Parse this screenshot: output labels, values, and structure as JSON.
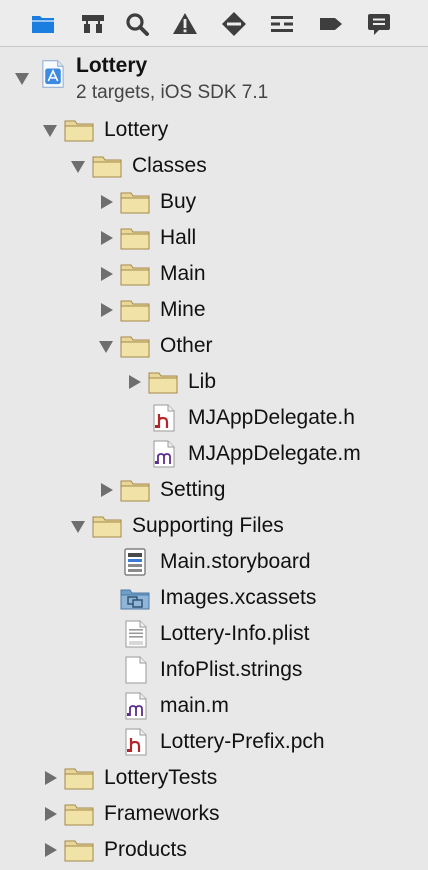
{
  "toolbar": {
    "buttons": [
      {
        "name": "project-navigator-icon",
        "active": true
      },
      {
        "name": "symbol-navigator-icon"
      },
      {
        "name": "find-navigator-icon"
      },
      {
        "name": "issue-navigator-icon"
      },
      {
        "name": "breakpoint-navigator-icon"
      },
      {
        "name": "debug-navigator-icon"
      },
      {
        "name": "tag-navigator-icon"
      },
      {
        "name": "log-navigator-icon"
      }
    ]
  },
  "project": {
    "title": "Lottery",
    "subtitle": "2 targets, iOS SDK 7.1",
    "icon": "xcode-project-icon"
  },
  "tree": [
    {
      "label": "Lottery",
      "depth": 1,
      "type": "folder",
      "expanded": true
    },
    {
      "label": "Classes",
      "depth": 2,
      "type": "folder",
      "expanded": true
    },
    {
      "label": "Buy",
      "depth": 3,
      "type": "folder",
      "expanded": false
    },
    {
      "label": "Hall",
      "depth": 3,
      "type": "folder",
      "expanded": false
    },
    {
      "label": "Main",
      "depth": 3,
      "type": "folder",
      "expanded": false
    },
    {
      "label": "Mine",
      "depth": 3,
      "type": "folder",
      "expanded": false
    },
    {
      "label": "Other",
      "depth": 3,
      "type": "folder",
      "expanded": true
    },
    {
      "label": "Lib",
      "depth": 4,
      "type": "folder",
      "expanded": false
    },
    {
      "label": "MJAppDelegate.h",
      "depth": 4,
      "type": "h"
    },
    {
      "label": "MJAppDelegate.m",
      "depth": 4,
      "type": "m"
    },
    {
      "label": "Setting",
      "depth": 3,
      "type": "folder",
      "expanded": false
    },
    {
      "label": "Supporting Files",
      "depth": 2,
      "type": "folder",
      "expanded": true
    },
    {
      "label": "Main.storyboard",
      "depth": 3,
      "type": "storyboard"
    },
    {
      "label": "Images.xcassets",
      "depth": 3,
      "type": "xcassets"
    },
    {
      "label": "Lottery-Info.plist",
      "depth": 3,
      "type": "plist"
    },
    {
      "label": "InfoPlist.strings",
      "depth": 3,
      "type": "strings"
    },
    {
      "label": "main.m",
      "depth": 3,
      "type": "m"
    },
    {
      "label": "Lottery-Prefix.pch",
      "depth": 3,
      "type": "h"
    },
    {
      "label": "LotteryTests",
      "depth": 1,
      "type": "folder",
      "expanded": false
    },
    {
      "label": "Frameworks",
      "depth": 1,
      "type": "folder",
      "expanded": false
    },
    {
      "label": "Products",
      "depth": 1,
      "type": "folder",
      "expanded": false
    }
  ],
  "colors": {
    "active_icon": "#1a7de0",
    "icon_gray": "#3e3e3e",
    "folder_fill": "#e9d79a",
    "folder_stroke": "#a3894a",
    "disclosure": "#6e6e6e"
  }
}
